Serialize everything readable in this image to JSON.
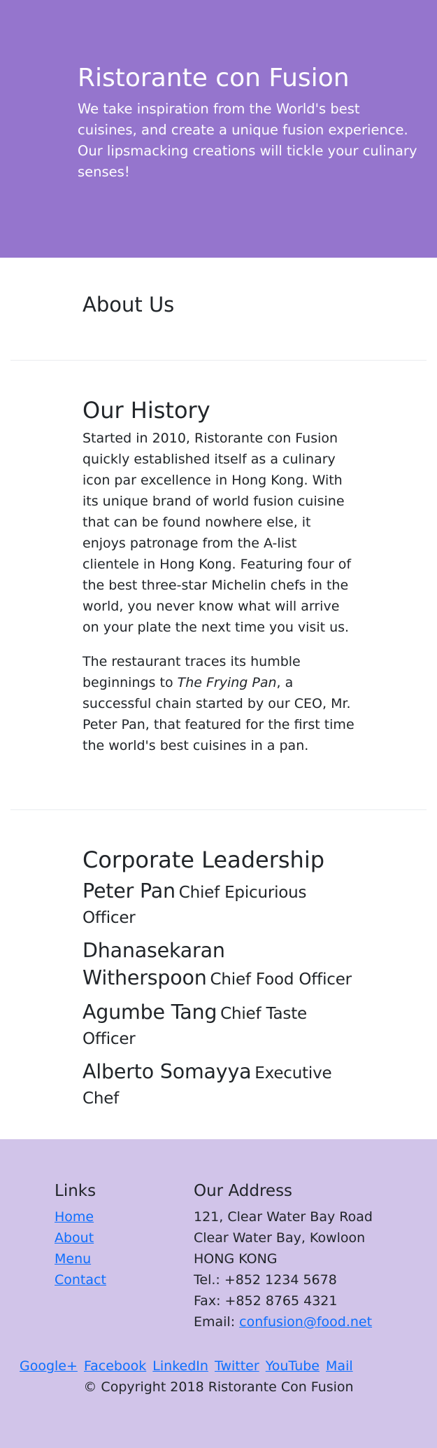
{
  "header": {
    "title": "Ristorante con Fusion",
    "tagline_1": "We take inspiration from the World's best cuisines, and create a unique fusion experience.",
    "tagline_2": "Our lipsmacking creations will tickle your culinary senses!"
  },
  "about": {
    "heading": "About Us"
  },
  "history": {
    "heading": "Our History",
    "para1": "Started in 2010, Ristorante con Fusion quickly established itself as a culinary icon par excellence in Hong Kong. With its unique brand of world fusion cuisine that can be found nowhere else, it enjoys patronage from the A-list clientele in Hong Kong. Featuring four of the best three-star Michelin chefs in the world, you never know what will arrive on your plate the next time you visit us.",
    "para2_prefix": "The restaurant traces its humble beginnings to ",
    "para2_italic": "The Frying Pan",
    "para2_suffix": ", a successful chain started by our CEO, Mr. Peter Pan, that featured for the first time the world's best cuisines in a pan."
  },
  "leadership": {
    "heading": "Corporate Leadership",
    "leaders": [
      {
        "name": "Peter Pan",
        "title": "Chief Epicurious Officer"
      },
      {
        "name": "Dhanasekaran Witherspoon",
        "title": "Chief Food Officer"
      },
      {
        "name": "Agumbe Tang",
        "title": "Chief Taste Officer"
      },
      {
        "name": "Alberto Somayya",
        "title": "Executive Chef"
      }
    ]
  },
  "footer": {
    "links_heading": "Links",
    "links": [
      "Home",
      "About",
      "Menu",
      "Contact"
    ],
    "address_heading": "Our Address",
    "address_lines": [
      "121, Clear Water Bay Road",
      "Clear Water Bay, Kowloon",
      "HONG KONG"
    ],
    "tel": "Tel.: +852 1234 5678",
    "fax": "Fax: +852 8765 4321",
    "email_label": "Email: ",
    "email": "confusion@food.net",
    "social": [
      "Google+",
      "Facebook",
      "LinkedIn",
      "Twitter",
      "YouTube",
      "Mail"
    ],
    "copyright": "© Copyright 2018 Ristorante Con Fusion"
  },
  "colors": {
    "header_bg": "#9575cd",
    "footer_bg": "#d1c4e9",
    "link": "#0d6efd"
  }
}
